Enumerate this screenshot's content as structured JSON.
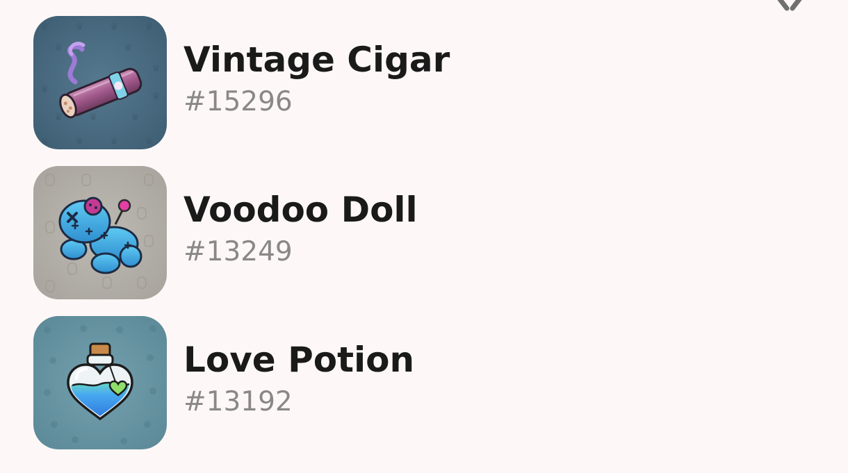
{
  "header": {
    "close_icon": "close-icon"
  },
  "items": [
    {
      "title": "Vintage Cigar",
      "number": "#15296",
      "icon": "cigar-icon",
      "background": "#4d6f85",
      "pattern_color": "#405e72"
    },
    {
      "title": "Voodoo Doll",
      "number": "#13249",
      "icon": "voodoo-doll-icon",
      "background": "#b4b1aa",
      "pattern_color": "#a8a49c"
    },
    {
      "title": "Love Potion",
      "number": "#13192",
      "icon": "love-potion-icon",
      "background": "#6a96a4",
      "pattern_color": "#5c8896"
    }
  ],
  "colors": {
    "page_background": "#fdf8f7",
    "title_text": "#1a1a1a",
    "number_text": "#8a8787",
    "close_icon": "#707070"
  }
}
